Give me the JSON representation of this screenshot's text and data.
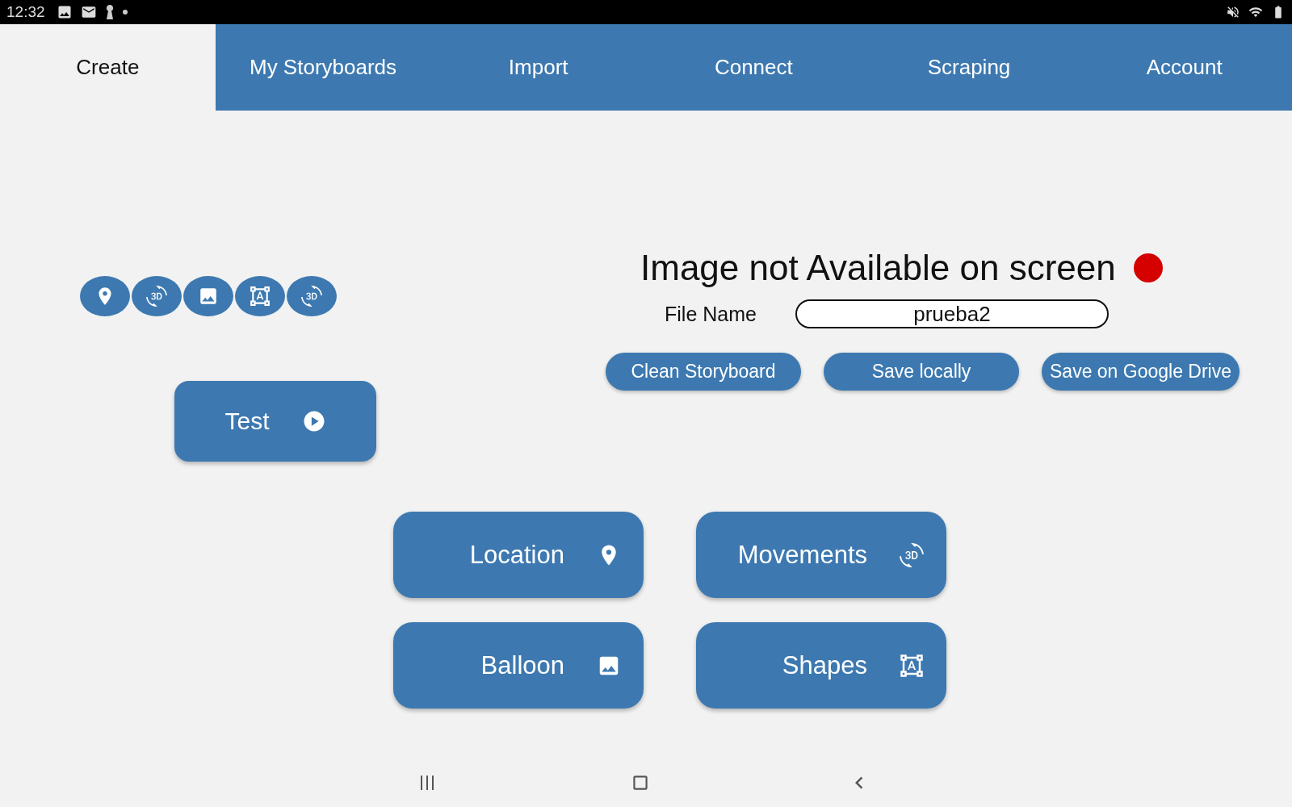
{
  "status_bar": {
    "time": "12:32"
  },
  "tabs": [
    {
      "label": "Create",
      "selected": true
    },
    {
      "label": "My Storyboards",
      "selected": false
    },
    {
      "label": "Import",
      "selected": false
    },
    {
      "label": "Connect",
      "selected": false
    },
    {
      "label": "Scraping",
      "selected": false
    },
    {
      "label": "Account",
      "selected": false
    }
  ],
  "quick_icons": [
    {
      "kind": "location"
    },
    {
      "kind": "rotate3d"
    },
    {
      "kind": "image"
    },
    {
      "kind": "shapes"
    },
    {
      "kind": "rotate3d"
    }
  ],
  "test_button": {
    "label": "Test"
  },
  "status": {
    "message": "Image not Available on screen"
  },
  "file": {
    "label": "File Name",
    "value": "prueba2"
  },
  "actions": [
    "Clean Storyboard",
    "Save locally",
    "Save on Google Drive"
  ],
  "tools": [
    {
      "label": "Location",
      "kind": "location"
    },
    {
      "label": "Movements",
      "kind": "rotate3d"
    },
    {
      "label": "Balloon",
      "kind": "image"
    },
    {
      "label": "Shapes",
      "kind": "shapes"
    }
  ]
}
